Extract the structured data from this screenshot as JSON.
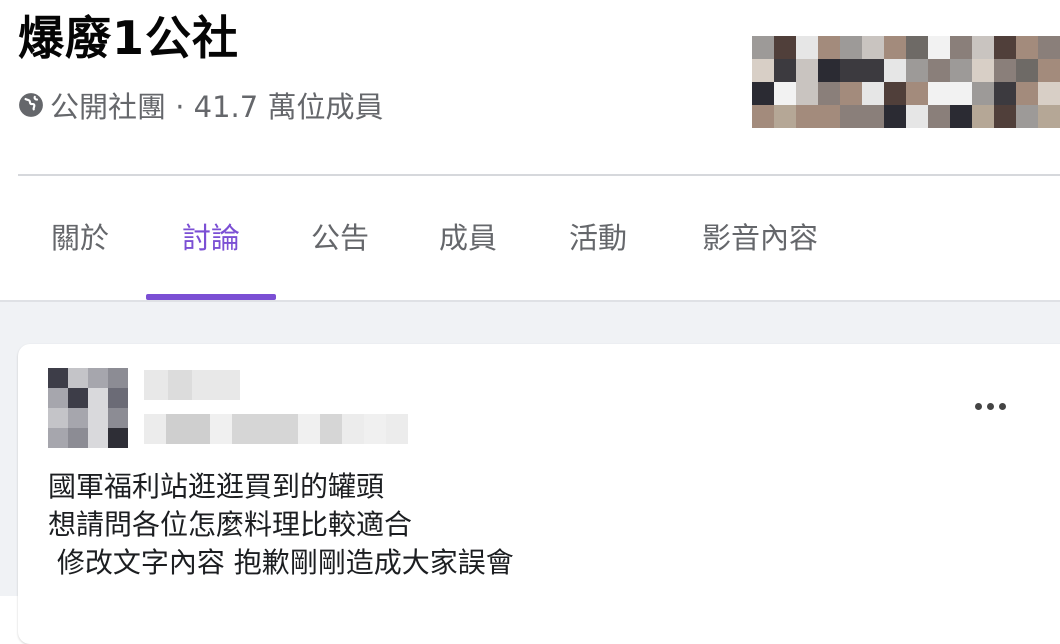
{
  "group": {
    "title": "爆廢1公社",
    "privacy_icon": "globe-icon",
    "meta": "公開社團 · 41.7 萬位成員"
  },
  "tabs": [
    {
      "label": "關於",
      "active": false
    },
    {
      "label": "討論",
      "active": true
    },
    {
      "label": "公告",
      "active": false
    },
    {
      "label": "成員",
      "active": false
    },
    {
      "label": "活動",
      "active": false
    },
    {
      "label": "影音內容",
      "active": false
    }
  ],
  "colors": {
    "accent": "#7b4fd4",
    "secondary_text": "#65676b",
    "feed_background": "#f0f2f5"
  },
  "post": {
    "more_icon": "more-options-icon",
    "lines": [
      "國軍福利站逛逛買到的罐頭",
      "想請問各位怎麼料理比較適合",
      " 修改文字內容 抱歉剛剛造成大家誤會"
    ]
  }
}
